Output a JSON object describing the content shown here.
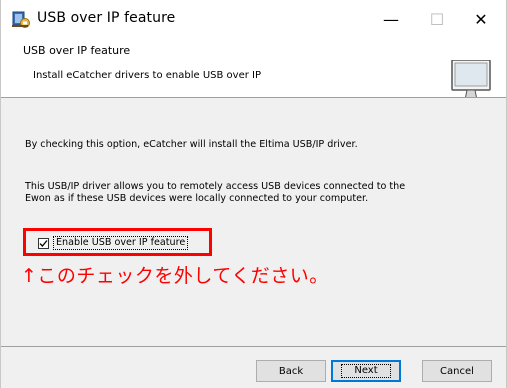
{
  "window": {
    "title": "USB over IP feature",
    "controls": {
      "minimize": "—",
      "maximize": "☐",
      "close": "✕"
    }
  },
  "header": {
    "title": "USB over IP feature",
    "subtitle": "Install eCatcher drivers to enable USB over IP",
    "icon": "computer-monitor-icon"
  },
  "content": {
    "paragraph1": "By checking this option, eCatcher will install the Eltima USB/IP driver.",
    "paragraph2_line1": "This USB/IP driver allows you to remotely access USB devices connected to the",
    "paragraph2_line2": "Ewon as if these USB devices were locally connected to your computer.",
    "checkbox": {
      "label": "Enable USB over IP feature",
      "checked": true
    },
    "annotation": "↑このチェックを外してください。",
    "annotation_color": "#ff0000"
  },
  "footer": {
    "back_label": "Back",
    "next_label": "Next",
    "cancel_label": "Cancel"
  },
  "colors": {
    "panel": "#f0f0f0",
    "accent": "#0078d7",
    "highlight": "#ff0000"
  }
}
